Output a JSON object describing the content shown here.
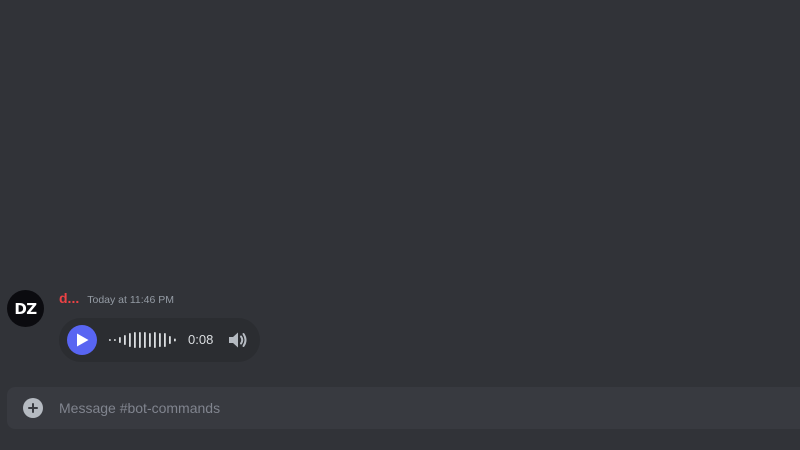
{
  "message": {
    "avatar_initials": "DZ",
    "username": "d...",
    "timestamp": "Today at 11:46 PM",
    "voice": {
      "duration": "0:08",
      "waveform_heights": [
        2,
        2,
        6,
        10,
        14,
        16,
        16,
        16,
        14,
        16,
        14,
        14,
        8,
        3
      ],
      "play_icon": "play-icon",
      "volume_icon": "speaker-icon"
    }
  },
  "composer": {
    "placeholder": "Message #bot-commands",
    "attach_icon": "plus-circle-icon"
  },
  "colors": {
    "background": "#313338",
    "username": "#ed4245",
    "accent": "#5865f2",
    "composer_bg": "#383a40",
    "voice_bg": "#2b2d31"
  }
}
